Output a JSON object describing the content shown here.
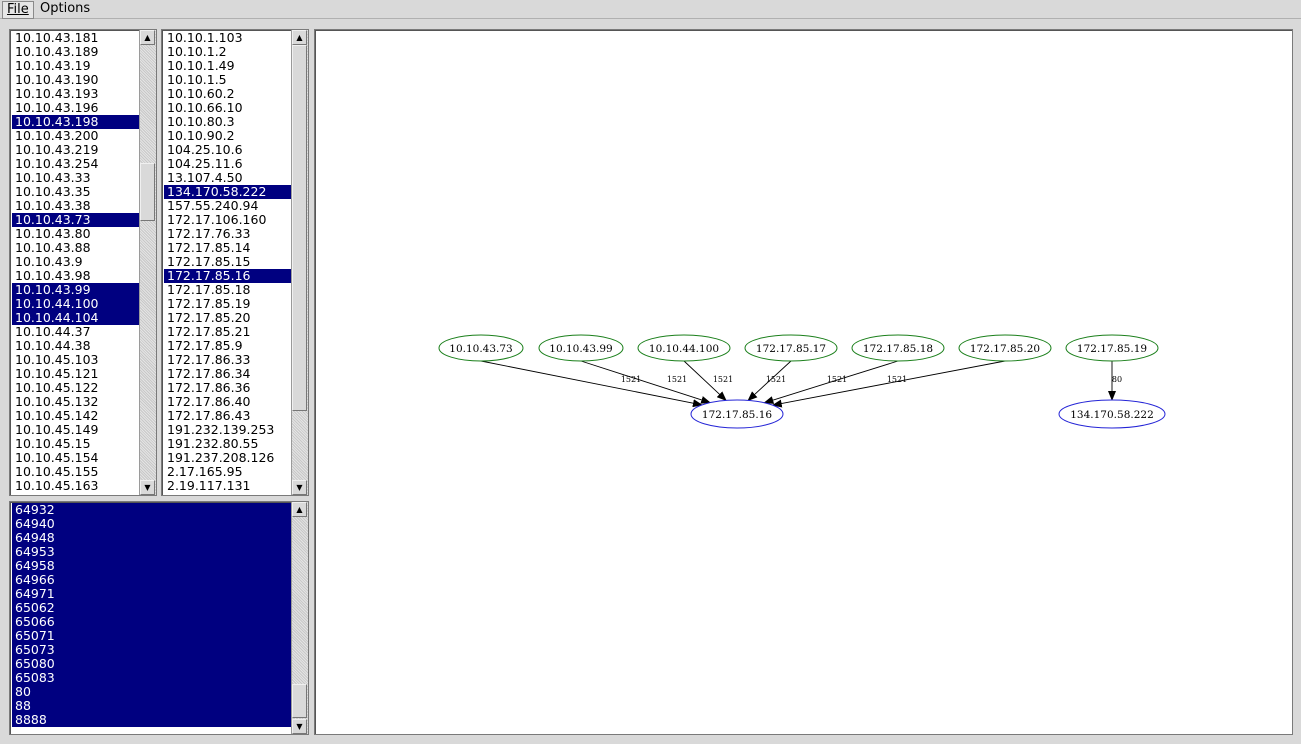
{
  "menu": {
    "file": "File",
    "options": "Options"
  },
  "lists": {
    "sources": {
      "items": [
        "10.10.43.181",
        "10.10.43.189",
        "10.10.43.19",
        "10.10.43.190",
        "10.10.43.193",
        "10.10.43.196",
        "10.10.43.198",
        "10.10.43.200",
        "10.10.43.219",
        "10.10.43.254",
        "10.10.43.33",
        "10.10.43.35",
        "10.10.43.38",
        "10.10.43.73",
        "10.10.43.80",
        "10.10.43.88",
        "10.10.43.9",
        "10.10.43.98",
        "10.10.43.99",
        "10.10.44.100",
        "10.10.44.104",
        "10.10.44.37",
        "10.10.44.38",
        "10.10.45.103",
        "10.10.45.121",
        "10.10.45.122",
        "10.10.45.132",
        "10.10.45.142",
        "10.10.45.149",
        "10.10.45.15",
        "10.10.45.154",
        "10.10.45.155",
        "10.10.45.163"
      ],
      "selected": [
        "10.10.43.198",
        "10.10.43.73",
        "10.10.43.99",
        "10.10.44.100",
        "10.10.44.104"
      ]
    },
    "destinations": {
      "items": [
        "10.10.1.103",
        "10.10.1.2",
        "10.10.1.49",
        "10.10.1.5",
        "10.10.60.2",
        "10.10.66.10",
        "10.10.80.3",
        "10.10.90.2",
        "104.25.10.6",
        "104.25.11.6",
        "13.107.4.50",
        "134.170.58.222",
        "157.55.240.94",
        "172.17.106.160",
        "172.17.76.33",
        "172.17.85.14",
        "172.17.85.15",
        "172.17.85.16",
        "172.17.85.18",
        "172.17.85.19",
        "172.17.85.20",
        "172.17.85.21",
        "172.17.85.9",
        "172.17.86.33",
        "172.17.86.34",
        "172.17.86.36",
        "172.17.86.40",
        "172.17.86.43",
        "191.232.139.253",
        "191.232.80.55",
        "191.237.208.126",
        "2.17.165.95",
        "2.19.117.131"
      ],
      "selected": [
        "134.170.58.222",
        "172.17.85.16"
      ]
    },
    "ports": {
      "items": [
        "64932",
        "64940",
        "64948",
        "64953",
        "64958",
        "64966",
        "64971",
        "65062",
        "65066",
        "65071",
        "65073",
        "65080",
        "65083",
        "80",
        "88",
        "8888"
      ],
      "selected": [
        "64932",
        "64940",
        "64948",
        "64953",
        "64958",
        "64966",
        "64971",
        "65062",
        "65066",
        "65071",
        "65073",
        "65080",
        "65083",
        "80",
        "88",
        "8888"
      ]
    }
  },
  "graph": {
    "nodes": [
      {
        "id": "10.10.43.73",
        "role": "source"
      },
      {
        "id": "10.10.43.99",
        "role": "source"
      },
      {
        "id": "10.10.44.100",
        "role": "source"
      },
      {
        "id": "172.17.85.17",
        "role": "source"
      },
      {
        "id": "172.17.85.18",
        "role": "source"
      },
      {
        "id": "172.17.85.20",
        "role": "source"
      },
      {
        "id": "172.17.85.19",
        "role": "source"
      },
      {
        "id": "172.17.85.16",
        "role": "destination"
      },
      {
        "id": "134.170.58.222",
        "role": "destination"
      }
    ],
    "edges": [
      {
        "from": "10.10.43.73",
        "to": "172.17.85.16",
        "label": "1521"
      },
      {
        "from": "10.10.43.99",
        "to": "172.17.85.16",
        "label": "1521"
      },
      {
        "from": "10.10.44.100",
        "to": "172.17.85.16",
        "label": "1521"
      },
      {
        "from": "172.17.85.17",
        "to": "172.17.85.16",
        "label": "1521"
      },
      {
        "from": "172.17.85.18",
        "to": "172.17.85.16",
        "label": "1521"
      },
      {
        "from": "172.17.85.20",
        "to": "172.17.85.16",
        "label": "1521"
      },
      {
        "from": "172.17.85.19",
        "to": "134.170.58.222",
        "label": "80"
      }
    ],
    "colors": {
      "source": "#1a7f1a",
      "destination": "#2424d6",
      "edge": "#000000"
    }
  },
  "icons": {
    "scroll_up": "arrow-up-icon",
    "scroll_down": "arrow-down-icon"
  }
}
